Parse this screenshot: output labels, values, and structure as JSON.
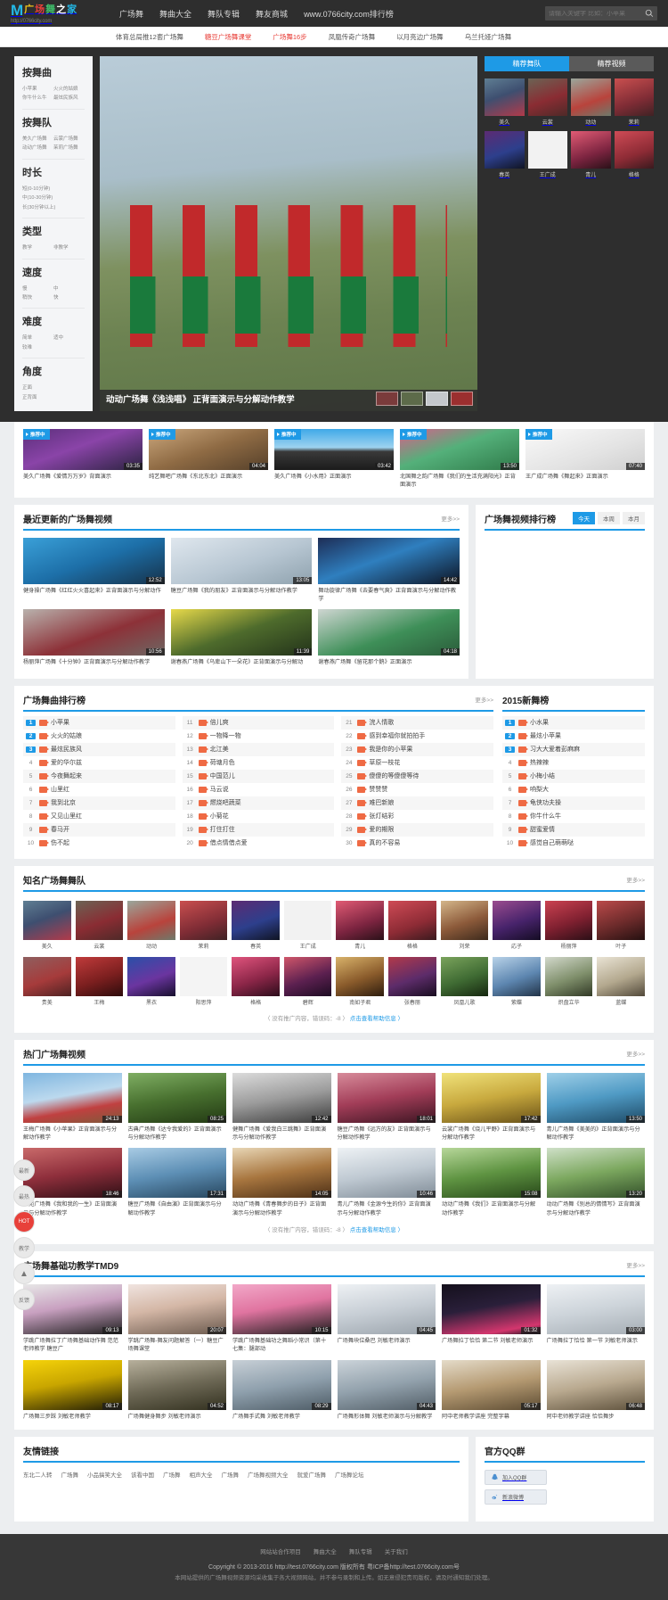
{
  "site": {
    "logo_main": "广场舞之家",
    "logo_mark": "M",
    "logo_url": "http://0766city.com"
  },
  "nav": {
    "items": [
      {
        "label": "广场舞"
      },
      {
        "label": "舞曲大全"
      },
      {
        "label": "舞队专辑"
      },
      {
        "label": "舞友商城"
      },
      {
        "label": "www.0766city.com排行榜"
      }
    ]
  },
  "search": {
    "placeholder": "请输入关键字 比如：小苹果",
    "icon": "search-icon"
  },
  "subnav": {
    "items": [
      {
        "label": "体育总局推12套广场舞",
        "hot": false
      },
      {
        "label": "糖豆广场舞课堂",
        "hot": true
      },
      {
        "label": "广场舞16步",
        "hot": true
      },
      {
        "label": "凤凰传奇广场舞",
        "hot": false
      },
      {
        "label": "以月亮边广场舞",
        "hot": false
      },
      {
        "label": "乌兰托娅广场舞",
        "hot": false
      }
    ]
  },
  "filters": {
    "groups": [
      {
        "title": "按舞曲",
        "items": [
          "小苹果",
          "火火的姑娘",
          "你牛什么牛",
          "最炫民族风"
        ]
      },
      {
        "title": "按舞队",
        "items": [
          "美久广场舞",
          "云裳广场舞",
          "动动广场舞",
          "茉莉广场舞"
        ]
      },
      {
        "title": "时长",
        "items": [
          "短(0-10分钟)",
          "中(10-30分钟)",
          "长(30分钟以上)"
        ]
      },
      {
        "title": "类型",
        "items": [
          "教学",
          "非教学"
        ]
      },
      {
        "title": "速度",
        "items": [
          "慢",
          "中",
          "稍快",
          "快"
        ]
      },
      {
        "title": "难度",
        "items": [
          "简单",
          "适中",
          "较难"
        ]
      },
      {
        "title": "角度",
        "items": [
          "正面",
          "正背面"
        ]
      }
    ]
  },
  "hero": {
    "caption": "动动广场舞《浅浅唱》 正背面演示与分解动作教学",
    "thumb_count": 4
  },
  "right_panel": {
    "tabs": [
      {
        "label": "精荐舞队",
        "active": true
      },
      {
        "label": "精荐视频",
        "active": false
      }
    ],
    "teams": [
      {
        "name": "美久"
      },
      {
        "name": "云裳"
      },
      {
        "name": "动动"
      },
      {
        "name": "茉莉"
      },
      {
        "name": "春英"
      },
      {
        "name": "王广成"
      },
      {
        "name": "青儿"
      },
      {
        "name": "格格"
      }
    ]
  },
  "top_strip": {
    "videos": [
      {
        "title": "美久广场舞《爱情万万岁》背面演示",
        "duration": "03:35",
        "badge": "推荐中"
      },
      {
        "title": "纯艺舞吧广场舞《东北东北》正面演示",
        "duration": "04:04",
        "badge": "推荐中"
      },
      {
        "title": "美久广场舞《小水用》正面演示",
        "duration": "03:42",
        "badge": "推荐中"
      },
      {
        "title": "北国舞之韵广场舞《我们的生活充满阳光》正背面演示",
        "duration": "13:50",
        "badge": "推荐中"
      },
      {
        "title": "王广成广场舞《舞起来》正面演示",
        "duration": "07:40",
        "badge": "推荐中"
      }
    ]
  },
  "updated": {
    "title": "最近更新的广场舞视频",
    "more": "更多>>",
    "videos": [
      {
        "title": "健身操广场舞《红红火火喜起来》正背面演示与分解动作",
        "duration": "12:52"
      },
      {
        "title": "糖豆广场舞《我的朋友》正背面演示与分解动作教学",
        "duration": "13:05"
      },
      {
        "title": "舞动旋律广场舞《去要春气爽》正背面演示与分解动作教学",
        "duration": "14:42"
      },
      {
        "title": "杨丽萍广场舞《十分钟》正背面演示与分解动作教学",
        "duration": "10:56"
      },
      {
        "title": "谢春燕广场舞《乌卑山下一朵花》正背面演示与分解动",
        "duration": "11:39"
      },
      {
        "title": "谢春燕广场舞《留花那个鹅》正面演示",
        "duration": "04:18"
      }
    ]
  },
  "video_rank": {
    "title": "广场舞视频排行榜",
    "tabs": [
      {
        "label": "今天",
        "active": true
      },
      {
        "label": "本周",
        "active": false
      },
      {
        "label": "本月",
        "active": false
      }
    ]
  },
  "song_rank": {
    "title": "广场舞曲排行榜",
    "more": "更多>>",
    "items": [
      {
        "no": "1",
        "name": "小苹果"
      },
      {
        "no": "2",
        "name": "火火的姑娘"
      },
      {
        "no": "3",
        "name": "最炫民族风"
      },
      {
        "no": "4",
        "name": "爱的华尔兹"
      },
      {
        "no": "5",
        "name": "今夜舞起来"
      },
      {
        "no": "6",
        "name": "山里红"
      },
      {
        "no": "7",
        "name": "我到北京"
      },
      {
        "no": "8",
        "name": "又见山里红"
      },
      {
        "no": "9",
        "name": "春马开"
      },
      {
        "no": "10",
        "name": "伤不起"
      },
      {
        "no": "11",
        "name": "倍儿爽"
      },
      {
        "no": "12",
        "name": "一物降一物"
      },
      {
        "no": "13",
        "name": "北江美"
      },
      {
        "no": "14",
        "name": "荷塘月色"
      },
      {
        "no": "15",
        "name": "中国范儿"
      },
      {
        "no": "16",
        "name": "马云说"
      },
      {
        "no": "17",
        "name": "燃烧吧蔬菜"
      },
      {
        "no": "18",
        "name": "小菊花"
      },
      {
        "no": "19",
        "name": "打住打住"
      },
      {
        "no": "20",
        "name": "借点情借点爱"
      },
      {
        "no": "21",
        "name": "浣人情歌"
      },
      {
        "no": "22",
        "name": "感到幸福你就拍拍手"
      },
      {
        "no": "23",
        "name": "我是你的小苹果"
      },
      {
        "no": "24",
        "name": "草原一枝花"
      },
      {
        "no": "25",
        "name": "傻傻的等傻傻等待"
      },
      {
        "no": "26",
        "name": "赞赞赞"
      },
      {
        "no": "27",
        "name": "难巴新娘"
      },
      {
        "no": "28",
        "name": "张灯结彩"
      },
      {
        "no": "29",
        "name": "爱的期限"
      },
      {
        "no": "30",
        "name": "真的不容易"
      }
    ]
  },
  "new_rank": {
    "title": "2015新舞榜",
    "items": [
      {
        "no": "1",
        "name": "小水果"
      },
      {
        "no": "2",
        "name": "最炫小苹果"
      },
      {
        "no": "3",
        "name": "习大大爱着彭麻麻"
      },
      {
        "no": "4",
        "name": "热辣辣"
      },
      {
        "no": "5",
        "name": "小梅小结"
      },
      {
        "no": "6",
        "name": "响梨大"
      },
      {
        "no": "7",
        "name": "龟侠功夫操"
      },
      {
        "no": "8",
        "name": "你牛什么牛"
      },
      {
        "no": "9",
        "name": "甜蜜爱情"
      },
      {
        "no": "10",
        "name": "感觉自己萌萌哒"
      }
    ]
  },
  "teams_section": {
    "title": "知名广场舞舞队",
    "more": "更多>>",
    "row1": [
      {
        "name": "美久"
      },
      {
        "name": "云裳"
      },
      {
        "name": "动动"
      },
      {
        "name": "茉莉"
      },
      {
        "name": "春英"
      },
      {
        "name": "王广成"
      },
      {
        "name": "青儿"
      },
      {
        "name": "格格"
      },
      {
        "name": "刘荣"
      },
      {
        "name": "応子"
      },
      {
        "name": "杨丽萍"
      },
      {
        "name": "叶子"
      }
    ],
    "row2": [
      {
        "name": "贵美"
      },
      {
        "name": "王梅"
      },
      {
        "name": "黑衣"
      },
      {
        "name": "阳思萍"
      },
      {
        "name": "格格"
      },
      {
        "name": "碧辉"
      },
      {
        "name": "南如子君"
      },
      {
        "name": "张春丽"
      },
      {
        "name": "凤凰儿歌"
      },
      {
        "name": "紫蝶"
      },
      {
        "name": "炽盘立华"
      },
      {
        "name": "蓝蝶"
      }
    ],
    "notice_prefix": "〈 没有推广内容，错误码：-8 〉",
    "notice_link": "点击查看帮助信息 〉"
  },
  "hot_videos": {
    "title": "热门广场舞视频",
    "more": "更多>>",
    "row1": [
      {
        "title": "王梅广场舞《小苹果》正背面演示与分解动作教学",
        "duration": "24:13"
      },
      {
        "title": "古典广场舞《达令我爱的》正背面演示与分解动作教学",
        "duration": "08:25"
      },
      {
        "title": "健舞广场舞《爱我白三跳舞》正背面演示与分解动作教学",
        "duration": "12:42"
      },
      {
        "title": "糖豆广场舞《远方的友》正背面演示与分解动作教学",
        "duration": "18:01"
      },
      {
        "title": "云裳广场舞《烧儿平野》正背面演示与分解动作教学",
        "duration": "17:42"
      },
      {
        "title": "青儿广场舞《美美的》正背面演示与分解动作教学",
        "duration": "13:50"
      }
    ],
    "row2": [
      {
        "title": "荣苑广场舞《我和我的一生》正背面演示与分解动作教学",
        "duration": "18:46"
      },
      {
        "title": "糖豆广场舞《自由演》正背面演示与分解动作教学",
        "duration": "17:31"
      },
      {
        "title": "动动广场舞《青春舞步的日子》正背面演示与分解动作教学",
        "duration": "14:05"
      },
      {
        "title": "青儿广场舞《金源今生的你》正背面演示与分解动作教学",
        "duration": "10:46"
      },
      {
        "title": "动动广场舞《我们》正背面演示与分解动作教学",
        "duration": "15:08"
      },
      {
        "title": "动动广场舞《别总的情情写》正背面演示与分解动作教学",
        "duration": "13:20"
      }
    ]
  },
  "basics": {
    "title": "广场舞基础功教学TMD9",
    "more": "更多>>",
    "row1": [
      {
        "title": "学跳广场舞拉丁广场舞基础动作舞 范范老师教学 糖豆广",
        "duration": "09:13"
      },
      {
        "title": "学跳广场舞-舞友问题解答（一）糖豆广场舞课堂",
        "duration": "20:07"
      },
      {
        "title": "学跳广场舞基础功之舞蹈小常识（第十七集：腿部动",
        "duration": "10:15"
      },
      {
        "title": "广场舞块位桑巴 刘敏老师演示",
        "duration": "04:45"
      },
      {
        "title": "广场舞拉丁恰恰 第二节 刘敏老师演示",
        "duration": "01:32"
      },
      {
        "title": "广场舞拉丁恰恰 第一节 刘敏老师演示",
        "duration": "03:00"
      }
    ],
    "row2": [
      {
        "title": "广场舞三步踩 刘敏老师教学",
        "duration": "08:17"
      },
      {
        "title": "广场舞健身舞步 刘敏老师演示",
        "duration": "04:52"
      },
      {
        "title": "广场舞手式舞 刘敏老师教学",
        "duration": "08:29"
      },
      {
        "title": "广场舞形体舞 刘敏老师演示与分解教学",
        "duration": "04:43"
      },
      {
        "title": "阿中老师教学讲座 完整字幕",
        "duration": "05:17"
      },
      {
        "title": "阿中老师教学讲座 恰恰舞步",
        "duration": "06:48"
      }
    ]
  },
  "friend_links": {
    "title": "友情链接",
    "items": [
      {
        "label": "东北二人转"
      },
      {
        "label": "广场舞"
      },
      {
        "label": "小品搞笑大全"
      },
      {
        "label": "该看中国"
      },
      {
        "label": "广场舞"
      },
      {
        "label": "相声大全"
      },
      {
        "label": "广场舞"
      },
      {
        "label": "广场舞视频大全"
      },
      {
        "label": "就爱广场舞"
      },
      {
        "label": "广场舞论坛"
      }
    ]
  },
  "qq_group": {
    "title": "官方QQ群",
    "buttons": [
      {
        "label": "加入QQ群",
        "icon": "qq-penguin-icon"
      },
      {
        "label": "新浪微博",
        "icon": "weibo-icon"
      }
    ]
  },
  "rail": {
    "items": [
      {
        "label": "最新"
      },
      {
        "label": "最热"
      },
      {
        "label": "HOT",
        "accent": true
      },
      {
        "label": "教学"
      },
      {
        "label": "▲"
      },
      {
        "label": "反馈"
      }
    ]
  },
  "footer": {
    "nav": [
      {
        "label": "网站站合作项目"
      },
      {
        "label": "舞曲大全"
      },
      {
        "label": "舞队专辑"
      },
      {
        "label": "关于我们"
      }
    ],
    "copyright": "Copyright © 2013-2016 http://test.0766city.com 版权所有 粤ICP备http://test.0766city.com号",
    "disclaimer": "本网站提供的广场舞视频资源均采收集于各大视频网站，并不参与录制和上传。如无意侵犯贵司版权，请及时通知我们处理。"
  },
  "colors": {
    "accent": "#1e9ae6",
    "hot": "#e8403a",
    "dark": "#2e2e2e"
  }
}
